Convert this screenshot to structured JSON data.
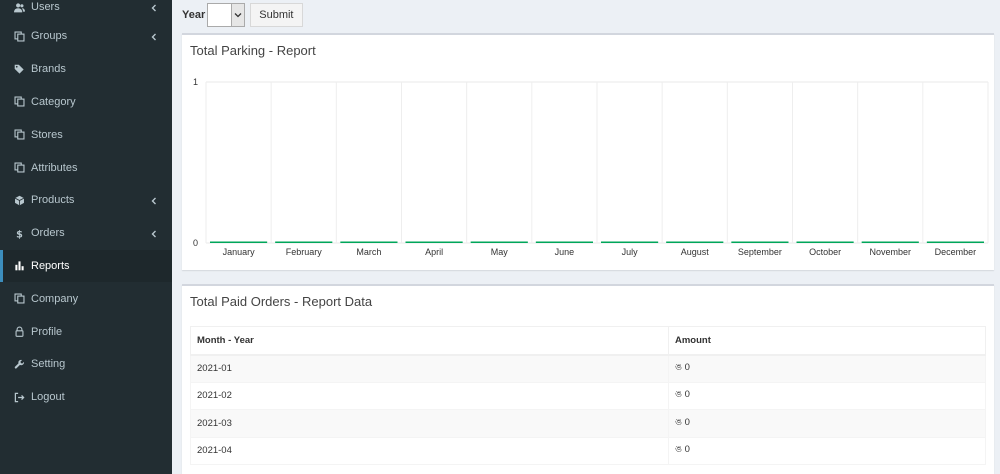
{
  "sidebar": {
    "items": [
      {
        "label": "Users",
        "icon": "users-icon",
        "chevron": true,
        "active": false
      },
      {
        "label": "Groups",
        "icon": "copy-icon",
        "chevron": true,
        "active": false
      },
      {
        "label": "Brands",
        "icon": "tags-icon",
        "chevron": false,
        "active": false
      },
      {
        "label": "Category",
        "icon": "copy-icon",
        "chevron": false,
        "active": false
      },
      {
        "label": "Stores",
        "icon": "copy-icon",
        "chevron": false,
        "active": false
      },
      {
        "label": "Attributes",
        "icon": "copy-icon",
        "chevron": false,
        "active": false
      },
      {
        "label": "Products",
        "icon": "cube-icon",
        "chevron": true,
        "active": false
      },
      {
        "label": "Orders",
        "icon": "dollar-icon",
        "chevron": true,
        "active": false
      },
      {
        "label": "Reports",
        "icon": "bar-chart-icon",
        "chevron": false,
        "active": true
      },
      {
        "label": "Company",
        "icon": "copy-icon",
        "chevron": false,
        "active": false
      },
      {
        "label": "Profile",
        "icon": "lock-icon",
        "chevron": false,
        "active": false
      },
      {
        "label": "Setting",
        "icon": "wrench-icon",
        "chevron": false,
        "active": false
      },
      {
        "label": "Logout",
        "icon": "sign-out-icon",
        "chevron": false,
        "active": false
      }
    ]
  },
  "filter": {
    "year_label": "Year",
    "year_value": "",
    "submit_label": "Submit"
  },
  "chart_box": {
    "title": "Total Parking - Report"
  },
  "chart_data": {
    "type": "bar",
    "categories": [
      "January",
      "February",
      "March",
      "April",
      "May",
      "June",
      "July",
      "August",
      "September",
      "October",
      "November",
      "December"
    ],
    "values": [
      0,
      0,
      0,
      0,
      0,
      0,
      0,
      0,
      0,
      0,
      0,
      0
    ],
    "title": "",
    "xlabel": "",
    "ylabel": "",
    "ylim": [
      0,
      1
    ],
    "yticks": [
      0,
      1
    ],
    "grid": true,
    "bar_color": "#00a65a"
  },
  "table_box": {
    "title": "Total Paid Orders - Report Data",
    "columns": [
      "Month - Year",
      "Amount"
    ],
    "rows": [
      {
        "month": "2021-01",
        "amount": "ঙ 0"
      },
      {
        "month": "2021-02",
        "amount": "ঙ 0"
      },
      {
        "month": "2021-03",
        "amount": "ঙ 0"
      },
      {
        "month": "2021-04",
        "amount": "ঙ 0"
      }
    ]
  },
  "colors": {
    "sidebar_bg": "#222d32",
    "active_bg": "#1e282c",
    "accent": "#3c8dbc",
    "bar": "#00a65a",
    "content_bg": "#ecf0f5"
  }
}
